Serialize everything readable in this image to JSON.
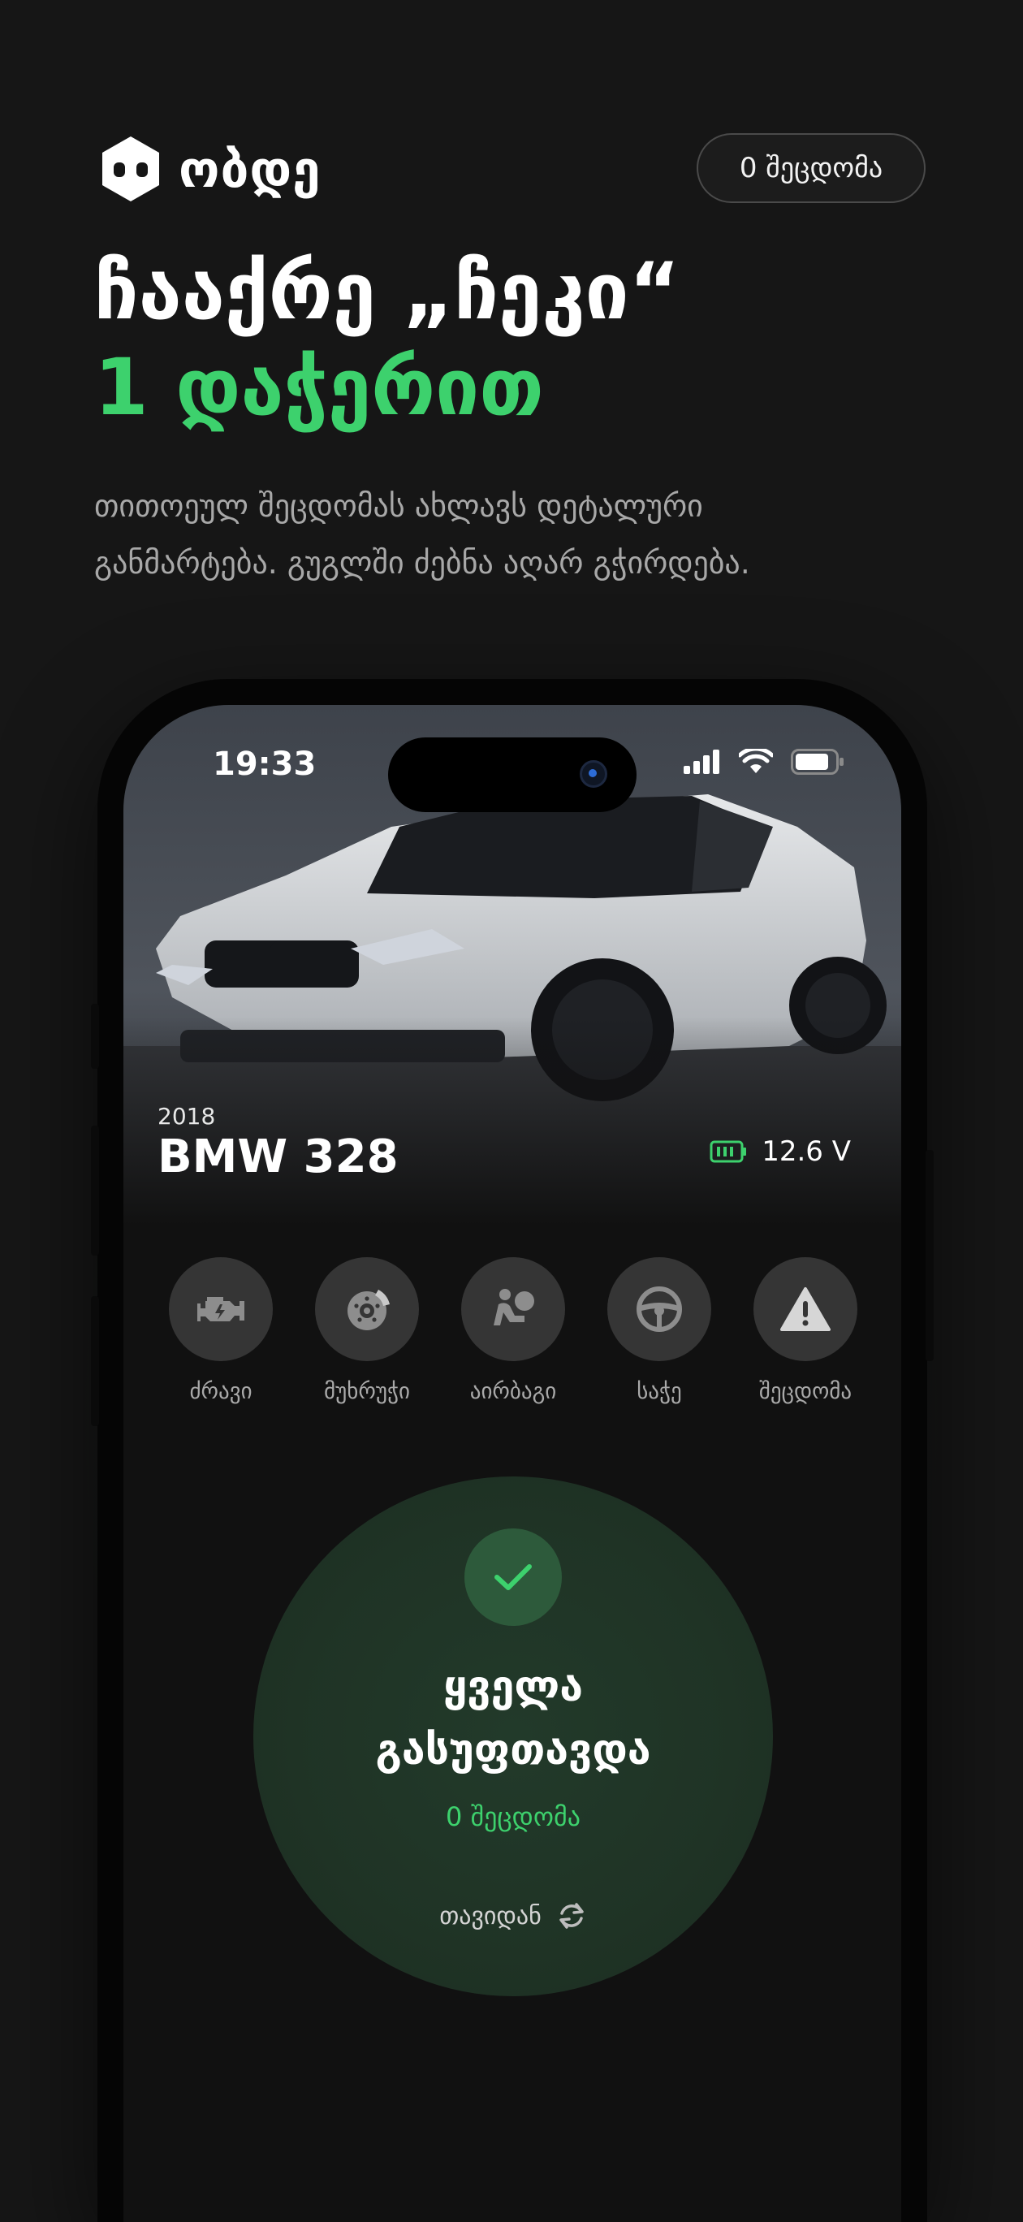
{
  "brand": {
    "name": "ობდე",
    "icon": "robot-face-icon"
  },
  "header_pill": {
    "label": "0 შეცდომა"
  },
  "headline": {
    "line1": "ჩააქრე „ჩეკი“",
    "line2": "1 დაჭერით"
  },
  "subtitle": {
    "line1": "თითოეულ შეცდომას ახლავს დეტალური",
    "line2": "განმარტება. გუგლში ძებნა აღარ გჭირდება."
  },
  "colors": {
    "accent": "#3dd16d",
    "background": "#161616"
  },
  "status_bar": {
    "time": "19:33",
    "icons": [
      "cellular-signal-icon",
      "wifi-icon",
      "battery-icon"
    ]
  },
  "car": {
    "year": "2018",
    "model": "BMW 328",
    "battery_voltage": "12.6 V",
    "voltage_icon": "car-battery-icon"
  },
  "categories": [
    {
      "label": "ძრავი",
      "icon": "engine-icon"
    },
    {
      "label": "მუხრუჭი",
      "icon": "brake-disc-icon"
    },
    {
      "label": "აირბაგი",
      "icon": "airbag-icon"
    },
    {
      "label": "საჭე",
      "icon": "steering-wheel-icon"
    },
    {
      "label": "შეცდომა",
      "icon": "warning-icon"
    }
  ],
  "result": {
    "title_line1": "ყველა",
    "title_line2": "გასუფთავდა",
    "count": "0 შეცდომა",
    "restart_label": "თავიდან",
    "restart_icon": "refresh-icon",
    "status_icon": "checkmark-icon"
  }
}
